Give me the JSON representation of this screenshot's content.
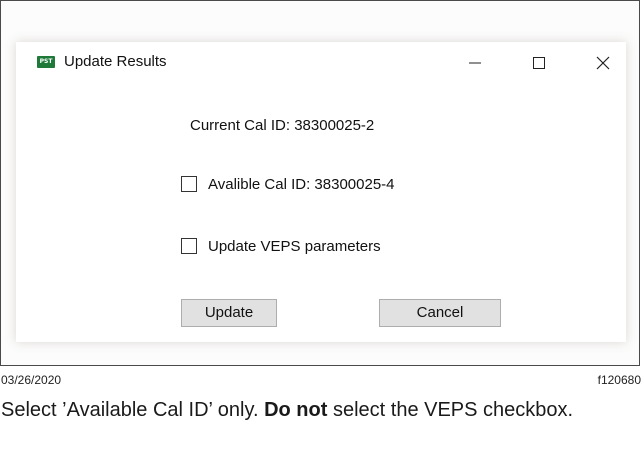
{
  "window": {
    "title": "Update Results",
    "app_icon_text": "PST",
    "minimize_icon": "minimize-icon",
    "maximize_icon": "maximize-icon",
    "close_icon": "close-icon"
  },
  "dialog": {
    "current_cal_id": "Current Cal ID: 38300025-2",
    "options": [
      {
        "label": "Avalible Cal ID: 38300025-4",
        "checked": false
      },
      {
        "label": "Update VEPS parameters",
        "checked": false
      }
    ],
    "update_label": "Update",
    "cancel_label": "Cancel"
  },
  "figure": {
    "date": "03/26/2020",
    "id": "f120680",
    "caption_part1": "Select ’Available Cal ID’ only. ",
    "caption_bold": "Do not",
    "caption_part2": " select the VEPS checkbox."
  }
}
